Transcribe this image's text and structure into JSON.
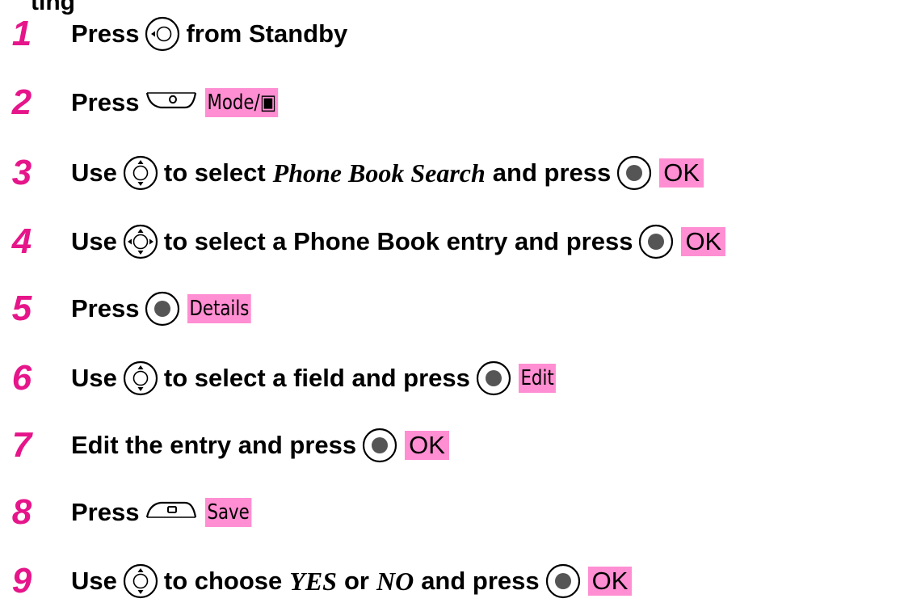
{
  "header_fragment": "ting",
  "steps": [
    {
      "num": "1",
      "parts": [
        {
          "k": "text",
          "v": "Press"
        },
        {
          "k": "key",
          "icon": "nav-left-key-icon"
        },
        {
          "k": "text",
          "v": "from Standby"
        }
      ]
    },
    {
      "num": "2",
      "parts": [
        {
          "k": "text",
          "v": "Press"
        },
        {
          "k": "key",
          "icon": "left-soft-key-icon"
        },
        {
          "k": "soft",
          "v": "Mode/▣",
          "style": "cond"
        }
      ]
    },
    {
      "num": "3",
      "parts": [
        {
          "k": "text",
          "v": "Use"
        },
        {
          "k": "key",
          "icon": "nav-updown-key-icon"
        },
        {
          "k": "text",
          "v": "to select"
        },
        {
          "k": "ital",
          "v": "Phone Book  Search"
        },
        {
          "k": "text",
          "v": "and press"
        },
        {
          "k": "key",
          "icon": "center-select-key-icon"
        },
        {
          "k": "soft",
          "v": "OK",
          "style": "big"
        }
      ]
    },
    {
      "num": "4",
      "parts": [
        {
          "k": "text",
          "v": "Use"
        },
        {
          "k": "key",
          "icon": "nav-4way-key-icon"
        },
        {
          "k": "text",
          "v": "to select a Phone Book entry and press"
        },
        {
          "k": "key",
          "icon": "center-select-key-icon"
        },
        {
          "k": "soft",
          "v": "OK",
          "style": "big"
        }
      ]
    },
    {
      "num": "5",
      "parts": [
        {
          "k": "text",
          "v": "Press"
        },
        {
          "k": "key",
          "icon": "center-select-key-icon"
        },
        {
          "k": "soft",
          "v": "Details",
          "style": "cond"
        }
      ]
    },
    {
      "num": "6",
      "parts": [
        {
          "k": "text",
          "v": "Use"
        },
        {
          "k": "key",
          "icon": "nav-updown-key-icon"
        },
        {
          "k": "text",
          "v": "to select a field and press"
        },
        {
          "k": "key",
          "icon": "center-select-key-icon"
        },
        {
          "k": "soft",
          "v": "Edit",
          "style": "cond"
        }
      ]
    },
    {
      "num": "7",
      "parts": [
        {
          "k": "text",
          "v": "Edit the entry and press"
        },
        {
          "k": "key",
          "icon": "center-select-key-icon"
        },
        {
          "k": "soft",
          "v": "OK",
          "style": "big"
        }
      ]
    },
    {
      "num": "8",
      "parts": [
        {
          "k": "text",
          "v": "Press"
        },
        {
          "k": "key",
          "icon": "right-soft-key-icon"
        },
        {
          "k": "soft",
          "v": "Save",
          "style": "cond"
        }
      ]
    },
    {
      "num": "9",
      "parts": [
        {
          "k": "text",
          "v": "Use"
        },
        {
          "k": "key",
          "icon": "nav-updown-key-icon"
        },
        {
          "k": "text",
          "v": "to choose"
        },
        {
          "k": "ital",
          "v": "YES"
        },
        {
          "k": "text",
          "v": "or"
        },
        {
          "k": "ital",
          "v": "NO"
        },
        {
          "k": "text",
          "v": "and press"
        },
        {
          "k": "key",
          "icon": "center-select-key-icon"
        },
        {
          "k": "soft",
          "v": "OK",
          "style": "big"
        }
      ]
    }
  ],
  "colors": {
    "step_number": "#e6158a",
    "softkey_highlight": "#ff8ed2",
    "text": "#000000"
  }
}
